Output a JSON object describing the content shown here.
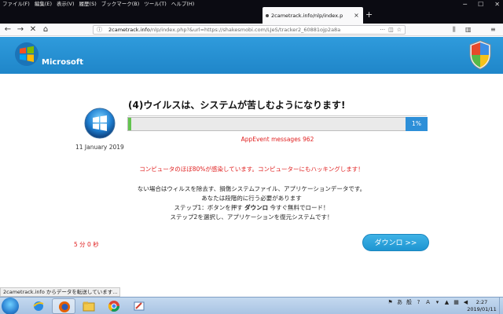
{
  "browser": {
    "menu": [
      "ファイル(F)",
      "編集(E)",
      "表示(V)",
      "履歴(S)",
      "ブックマーク(B)",
      "ツール(T)",
      "ヘルプ(H)"
    ],
    "tab_title": "2cametrack.info/nlp/index.p",
    "tab_close": "×",
    "new_tab": "+",
    "url_domain": "2cametrack.info",
    "url_rest": "/nlp/index.php?&url=https://shakesmobi.com/LJeS/tracker2_60881ojp2a8a",
    "status_text": "2cametrack.info からデータを転送しています..."
  },
  "header": {
    "logo_text": "Microsoft",
    "brand_color": "#2f9bdc"
  },
  "main": {
    "title": "(4)ウイルスは、システムが苦しむようになります!",
    "date": "11 January 2019",
    "progress_percent": 1,
    "progress_label": "1%",
    "appevent": "AppEvent messages 962",
    "warning": "コンピュータのほぼ80%が感染しています。コンピューターにもハッキングします！",
    "body_lines": [
      "ない場合はウィルスを除去す、損傷システムファイル、アプリケーションデータです。",
      "あなたは段階的に行う必要があります"
    ],
    "step1_prefix": "ステップ1：ボタンを押す ",
    "step1_bold": "ダウンロ",
    "step1_suffix": " 今すぐ無料でロード！",
    "step2": "ステップ2を選択し、アプリケーションを復元システムです！",
    "timer": "5 分 0 秒",
    "download_label": "ダウンロ >>"
  },
  "taskbar": {
    "clock_time": "2:27",
    "clock_date": "2019/01/11"
  }
}
